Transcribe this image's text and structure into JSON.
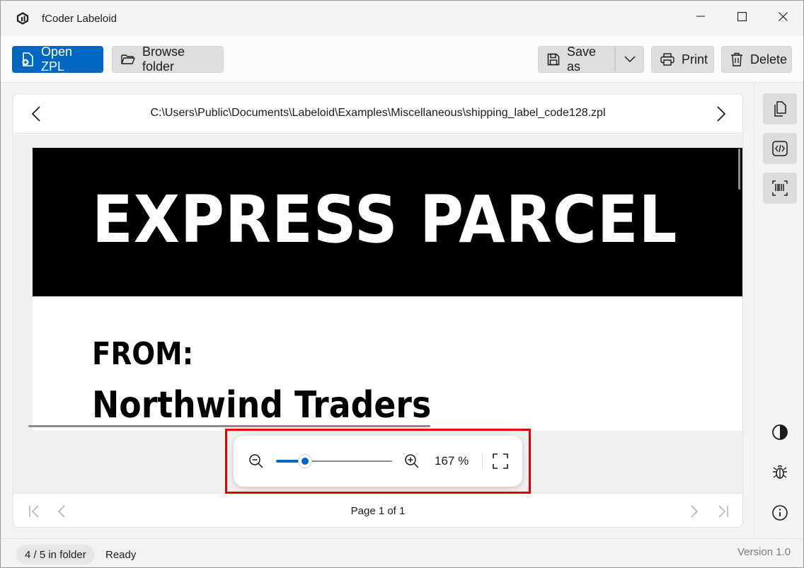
{
  "window": {
    "title": "fCoder Labeloid",
    "controls": [
      "minimize",
      "maximize",
      "close"
    ]
  },
  "toolbar": {
    "open_label": "Open ZPL",
    "browse_label": "Browse folder",
    "save_as_label": "Save as",
    "print_label": "Print",
    "delete_label": "Delete"
  },
  "document": {
    "path": "C:\\Users\\Public\\Documents\\Labeloid\\Examples\\Miscellaneous\\shipping_label_code128.zpl"
  },
  "label": {
    "banner": "EXPRESS PARCEL",
    "from_heading": "FROM:",
    "from_company": "Northwind Traders"
  },
  "zoom": {
    "value_text": "167 %",
    "slider_fraction": 0.25
  },
  "pager": {
    "page_text": "Page 1 of 1"
  },
  "sidebar": {
    "top_buttons": [
      "document-icon",
      "code-icon",
      "barcode-icon"
    ],
    "bottom_buttons": [
      "contrast-icon",
      "bug-icon",
      "info-icon"
    ]
  },
  "status": {
    "folder_position": "4 / 5 in folder",
    "state": "Ready",
    "version": "Version 1.0"
  },
  "colors": {
    "accent": "#0067c0",
    "highlight": "#e00000"
  }
}
